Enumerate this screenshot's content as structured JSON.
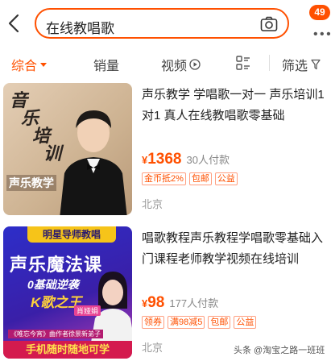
{
  "header": {
    "search_value": "在线教唱歌",
    "message_badge": "49"
  },
  "tabs": [
    {
      "label": "综合",
      "active": true
    },
    {
      "label": "销量",
      "active": false
    },
    {
      "label": "视频",
      "active": false
    },
    {
      "label": "筛选",
      "active": false
    }
  ],
  "products": [
    {
      "title": "声乐教学 学唱歌一对一 声乐培训1对1 真人在线教唱歌零基础",
      "currency": "¥",
      "price": "1368",
      "sold": "30人付款",
      "tags": [
        "金币抵2%",
        "包邮",
        "公益"
      ],
      "location": "北京",
      "thumb_text": {
        "c1": "音",
        "c2": "乐",
        "c3": "培",
        "c4": "训",
        "caption": "声乐教学"
      }
    },
    {
      "title": "唱歌教程声乐教程学唱歌零基础入门课程老师教学视频在线培训",
      "currency": "¥",
      "price": "98",
      "sold": "177人付款",
      "tags": [
        "领券",
        "满98减5",
        "包邮",
        "公益"
      ],
      "location": "北京",
      "thumb_text": {
        "banner": "明星导师教唱",
        "main": "声乐魔法课",
        "sub": "0基础逆袭",
        "gold": "K歌之王",
        "name": "肖娅娟",
        "tagline": "《唯忘今宵》曲作者徐景新弟子",
        "bottom": "手机随时随地可学"
      }
    }
  ],
  "watermark": "头条 @淘宝之路一班班",
  "colors": {
    "accent": "#ff5000",
    "badge": "#ff5000",
    "thumb2_bottom": "#d41a4e"
  },
  "icons": {
    "back": "chevron-left-icon",
    "camera": "camera-icon",
    "sort": "caret-down-icon",
    "video": "play-circle-icon",
    "layout": "grid-list-icon",
    "filter": "funnel-icon"
  }
}
